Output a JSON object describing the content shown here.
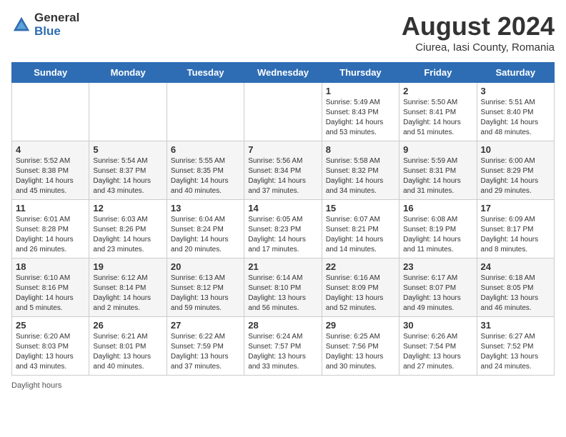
{
  "header": {
    "logo_general": "General",
    "logo_blue": "Blue",
    "month_year": "August 2024",
    "location": "Ciurea, Iasi County, Romania"
  },
  "weekdays": [
    "Sunday",
    "Monday",
    "Tuesday",
    "Wednesday",
    "Thursday",
    "Friday",
    "Saturday"
  ],
  "weeks": [
    [
      {
        "day": "",
        "info": ""
      },
      {
        "day": "",
        "info": ""
      },
      {
        "day": "",
        "info": ""
      },
      {
        "day": "",
        "info": ""
      },
      {
        "day": "1",
        "info": "Sunrise: 5:49 AM\nSunset: 8:43 PM\nDaylight: 14 hours\nand 53 minutes."
      },
      {
        "day": "2",
        "info": "Sunrise: 5:50 AM\nSunset: 8:41 PM\nDaylight: 14 hours\nand 51 minutes."
      },
      {
        "day": "3",
        "info": "Sunrise: 5:51 AM\nSunset: 8:40 PM\nDaylight: 14 hours\nand 48 minutes."
      }
    ],
    [
      {
        "day": "4",
        "info": "Sunrise: 5:52 AM\nSunset: 8:38 PM\nDaylight: 14 hours\nand 45 minutes."
      },
      {
        "day": "5",
        "info": "Sunrise: 5:54 AM\nSunset: 8:37 PM\nDaylight: 14 hours\nand 43 minutes."
      },
      {
        "day": "6",
        "info": "Sunrise: 5:55 AM\nSunset: 8:35 PM\nDaylight: 14 hours\nand 40 minutes."
      },
      {
        "day": "7",
        "info": "Sunrise: 5:56 AM\nSunset: 8:34 PM\nDaylight: 14 hours\nand 37 minutes."
      },
      {
        "day": "8",
        "info": "Sunrise: 5:58 AM\nSunset: 8:32 PM\nDaylight: 14 hours\nand 34 minutes."
      },
      {
        "day": "9",
        "info": "Sunrise: 5:59 AM\nSunset: 8:31 PM\nDaylight: 14 hours\nand 31 minutes."
      },
      {
        "day": "10",
        "info": "Sunrise: 6:00 AM\nSunset: 8:29 PM\nDaylight: 14 hours\nand 29 minutes."
      }
    ],
    [
      {
        "day": "11",
        "info": "Sunrise: 6:01 AM\nSunset: 8:28 PM\nDaylight: 14 hours\nand 26 minutes."
      },
      {
        "day": "12",
        "info": "Sunrise: 6:03 AM\nSunset: 8:26 PM\nDaylight: 14 hours\nand 23 minutes."
      },
      {
        "day": "13",
        "info": "Sunrise: 6:04 AM\nSunset: 8:24 PM\nDaylight: 14 hours\nand 20 minutes."
      },
      {
        "day": "14",
        "info": "Sunrise: 6:05 AM\nSunset: 8:23 PM\nDaylight: 14 hours\nand 17 minutes."
      },
      {
        "day": "15",
        "info": "Sunrise: 6:07 AM\nSunset: 8:21 PM\nDaylight: 14 hours\nand 14 minutes."
      },
      {
        "day": "16",
        "info": "Sunrise: 6:08 AM\nSunset: 8:19 PM\nDaylight: 14 hours\nand 11 minutes."
      },
      {
        "day": "17",
        "info": "Sunrise: 6:09 AM\nSunset: 8:17 PM\nDaylight: 14 hours\nand 8 minutes."
      }
    ],
    [
      {
        "day": "18",
        "info": "Sunrise: 6:10 AM\nSunset: 8:16 PM\nDaylight: 14 hours\nand 5 minutes."
      },
      {
        "day": "19",
        "info": "Sunrise: 6:12 AM\nSunset: 8:14 PM\nDaylight: 14 hours\nand 2 minutes."
      },
      {
        "day": "20",
        "info": "Sunrise: 6:13 AM\nSunset: 8:12 PM\nDaylight: 13 hours\nand 59 minutes."
      },
      {
        "day": "21",
        "info": "Sunrise: 6:14 AM\nSunset: 8:10 PM\nDaylight: 13 hours\nand 56 minutes."
      },
      {
        "day": "22",
        "info": "Sunrise: 6:16 AM\nSunset: 8:09 PM\nDaylight: 13 hours\nand 52 minutes."
      },
      {
        "day": "23",
        "info": "Sunrise: 6:17 AM\nSunset: 8:07 PM\nDaylight: 13 hours\nand 49 minutes."
      },
      {
        "day": "24",
        "info": "Sunrise: 6:18 AM\nSunset: 8:05 PM\nDaylight: 13 hours\nand 46 minutes."
      }
    ],
    [
      {
        "day": "25",
        "info": "Sunrise: 6:20 AM\nSunset: 8:03 PM\nDaylight: 13 hours\nand 43 minutes."
      },
      {
        "day": "26",
        "info": "Sunrise: 6:21 AM\nSunset: 8:01 PM\nDaylight: 13 hours\nand 40 minutes."
      },
      {
        "day": "27",
        "info": "Sunrise: 6:22 AM\nSunset: 7:59 PM\nDaylight: 13 hours\nand 37 minutes."
      },
      {
        "day": "28",
        "info": "Sunrise: 6:24 AM\nSunset: 7:57 PM\nDaylight: 13 hours\nand 33 minutes."
      },
      {
        "day": "29",
        "info": "Sunrise: 6:25 AM\nSunset: 7:56 PM\nDaylight: 13 hours\nand 30 minutes."
      },
      {
        "day": "30",
        "info": "Sunrise: 6:26 AM\nSunset: 7:54 PM\nDaylight: 13 hours\nand 27 minutes."
      },
      {
        "day": "31",
        "info": "Sunrise: 6:27 AM\nSunset: 7:52 PM\nDaylight: 13 hours\nand 24 minutes."
      }
    ]
  ],
  "footer": "Daylight hours"
}
